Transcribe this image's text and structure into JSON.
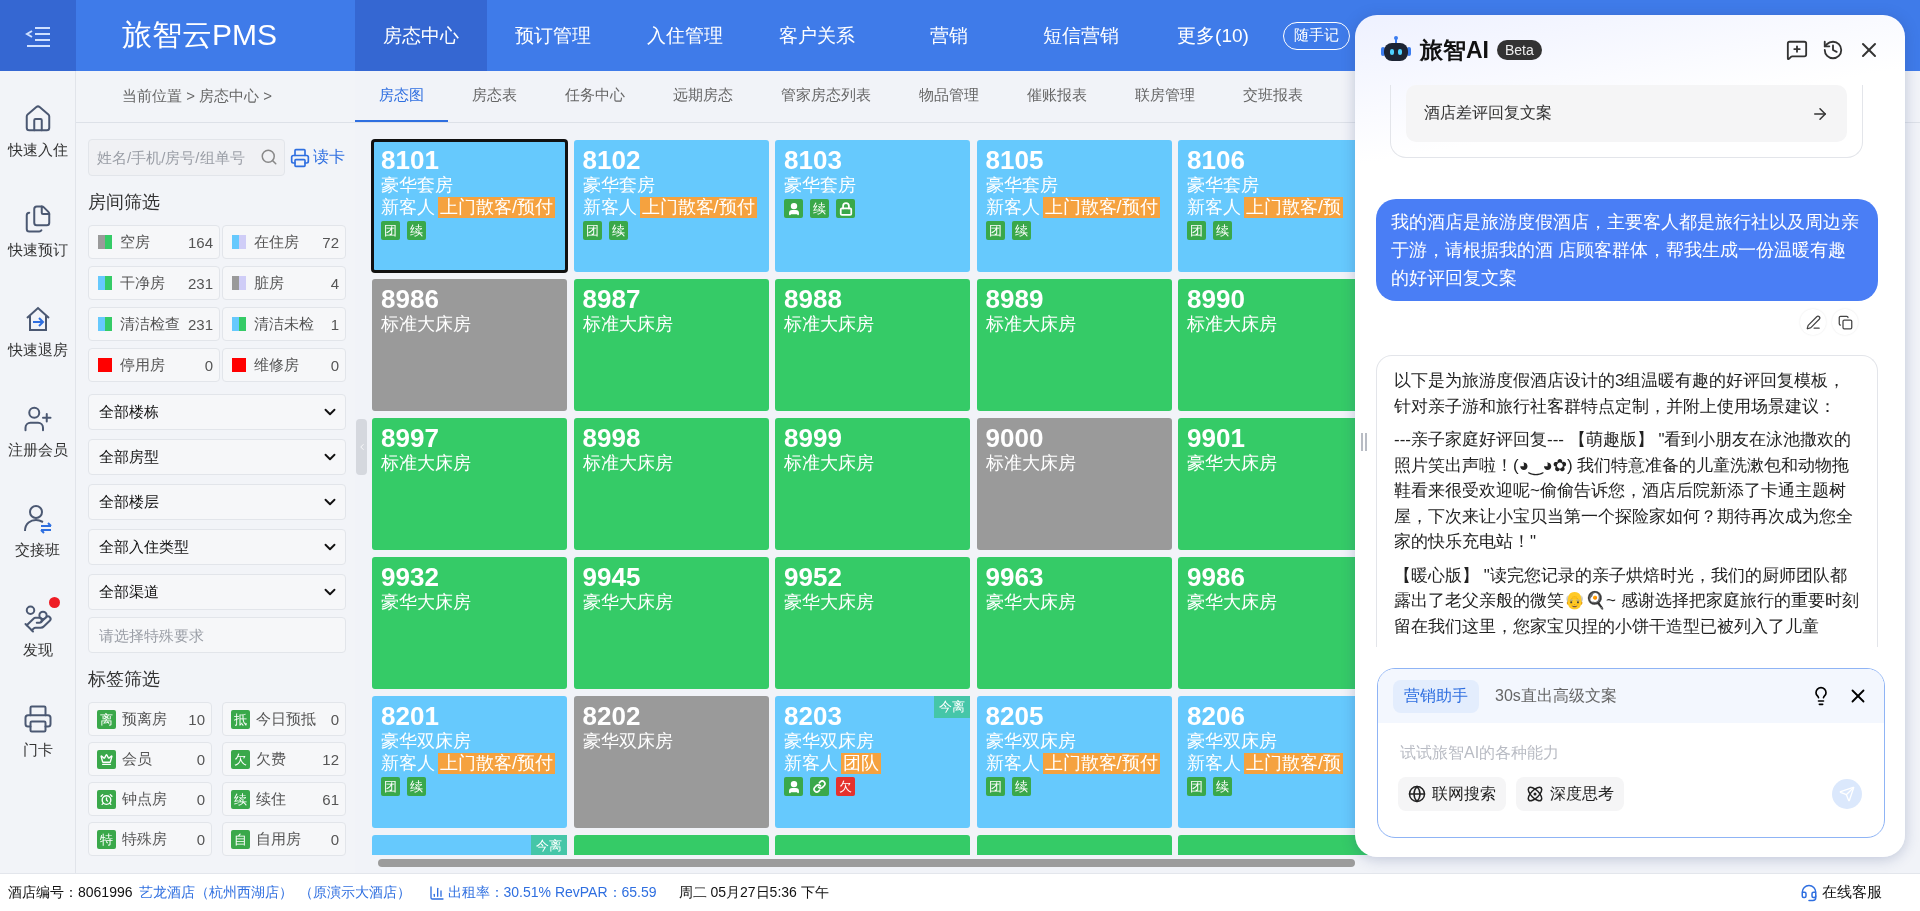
{
  "top_nav": {
    "logo": "旅智云PMS",
    "items": [
      {
        "label": "房态中心",
        "selected": true
      },
      {
        "label": "预订管理",
        "selected": false
      },
      {
        "label": "入住管理",
        "selected": false
      },
      {
        "label": "客户关系",
        "selected": false
      },
      {
        "label": "营销",
        "selected": false
      },
      {
        "label": "短信营销",
        "selected": false
      },
      {
        "label": "更多(10)",
        "selected": false
      }
    ],
    "memo_button": "随手记"
  },
  "sidebar": {
    "items": [
      {
        "kind": "checkin",
        "label": "快速入住",
        "badge": false
      },
      {
        "kind": "booking",
        "label": "快速预订",
        "badge": false
      },
      {
        "kind": "checkout",
        "label": "快速退房",
        "badge": false
      },
      {
        "kind": "member",
        "label": "注册会员",
        "badge": false
      },
      {
        "kind": "handover",
        "label": "交接班",
        "badge": false
      },
      {
        "kind": "discover",
        "label": "发现",
        "badge": true
      },
      {
        "kind": "card",
        "label": "门卡",
        "badge": false
      }
    ]
  },
  "breadcrumb": "当前位置 > 房态中心 >",
  "tabs": [
    {
      "label": "房态图",
      "selected": true
    },
    {
      "label": "房态表",
      "selected": false
    },
    {
      "label": "任务中心",
      "selected": false
    },
    {
      "label": "远期房态",
      "selected": false
    },
    {
      "label": "管家房态列表",
      "selected": false
    },
    {
      "label": "物品管理",
      "selected": false
    },
    {
      "label": "催账报表",
      "selected": false
    },
    {
      "label": "联房管理",
      "selected": false
    },
    {
      "label": "交班报表",
      "selected": false
    }
  ],
  "filter_panel": {
    "search": {
      "placeholder": "姓名/手机/房号/组单号"
    },
    "card_reader": "读卡",
    "room_filter_title": "房间筛选",
    "room_filters": [
      {
        "label": "空房",
        "count": "164",
        "swatch": [
          {
            "color": "#9a9a9a"
          },
          {
            "color": "#35cb67"
          }
        ]
      },
      {
        "label": "在住房",
        "count": "72",
        "swatch": [
          {
            "color": "#66c9fd"
          },
          {
            "color": "#cfcdf7"
          }
        ]
      },
      {
        "label": "干净房",
        "count": "231",
        "swatch": [
          {
            "color": "#66c9fd"
          },
          {
            "color": "#35cb67"
          }
        ]
      },
      {
        "label": "脏房",
        "count": "4",
        "swatch": [
          {
            "color": "#9a9a9a"
          },
          {
            "color": "#cfcdf7"
          }
        ]
      },
      {
        "label": "清洁检查",
        "count": "231",
        "swatch": [
          {
            "color": "#66c9fd"
          },
          {
            "color": "#35cb67"
          }
        ]
      },
      {
        "label": "清洁未检",
        "count": "1",
        "swatch": [
          {
            "color": "#66c9fd"
          },
          {
            "color": "#35cb67"
          }
        ]
      },
      {
        "label": "停用房",
        "count": "0",
        "swatch": [
          {
            "color": "#ff0000"
          }
        ]
      },
      {
        "label": "维修房",
        "count": "0",
        "swatch": [
          {
            "color": "#ff0000"
          }
        ]
      }
    ],
    "selects": [
      "全部楼栋",
      "全部房型",
      "全部楼层",
      "全部入住类型",
      "全部渠道"
    ],
    "special_requirement": {
      "placeholder": "请选择特殊要求"
    },
    "tag_filter_title": "标签筛选",
    "tag_filters": [
      {
        "kind": "char",
        "mark": "离",
        "label": "预离房",
        "count": "10"
      },
      {
        "kind": "char",
        "mark": "抵",
        "label": "今日预抵",
        "count": "0"
      },
      {
        "kind": "vip",
        "label": "会员",
        "count": "0"
      },
      {
        "kind": "char",
        "mark": "欠",
        "label": "欠费",
        "count": "12"
      },
      {
        "kind": "clock",
        "label": "钟点房",
        "count": "0"
      },
      {
        "kind": "char",
        "mark": "续",
        "label": "续住",
        "count": "61"
      },
      {
        "kind": "char",
        "mark": "特",
        "label": "特殊房",
        "count": "0"
      },
      {
        "kind": "char",
        "mark": "自",
        "label": "自用房",
        "count": "0"
      }
    ]
  },
  "rooms": [
    {
      "number": "8101",
      "type": "豪华套房",
      "color": "#66c9fd",
      "selected": true,
      "guest": "新客人",
      "source": "上门散客/预付",
      "icons": [
        {
          "kind": "tag",
          "label": "团"
        },
        {
          "kind": "tag",
          "label": "续"
        }
      ]
    },
    {
      "number": "8102",
      "type": "豪华套房",
      "color": "#66c9fd",
      "selected": false,
      "guest": "新客人",
      "source": "上门散客/预付",
      "icons": [
        {
          "kind": "tag",
          "label": "团"
        },
        {
          "kind": "tag",
          "label": "续"
        }
      ]
    },
    {
      "number": "8103",
      "type": "豪华套房",
      "color": "#66c9fd",
      "selected": false,
      "icons": [
        {
          "kind": "person"
        },
        {
          "kind": "tag",
          "label": "续"
        },
        {
          "kind": "lock"
        }
      ]
    },
    {
      "number": "8105",
      "type": "豪华套房",
      "color": "#66c9fd",
      "selected": false,
      "guest": "新客人",
      "source": "上门散客/预付",
      "icons": [
        {
          "kind": "tag",
          "label": "团"
        },
        {
          "kind": "tag",
          "label": "续"
        }
      ]
    },
    {
      "number": "8106",
      "type": "豪华套房",
      "color": "#66c9fd",
      "selected": false,
      "guest": "新客人",
      "source": "上门散客/预",
      "icons": [
        {
          "kind": "tag",
          "label": "团"
        },
        {
          "kind": "tag",
          "label": "续"
        }
      ]
    },
    {
      "number": "8986",
      "type": "标准大床房",
      "color": "#9a9a9a",
      "selected": false
    },
    {
      "number": "8987",
      "type": "标准大床房",
      "color": "#35cb67",
      "selected": false
    },
    {
      "number": "8988",
      "type": "标准大床房",
      "color": "#35cb67",
      "selected": false
    },
    {
      "number": "8989",
      "type": "标准大床房",
      "color": "#35cb67",
      "selected": false
    },
    {
      "number": "8990",
      "type": "标准大床房",
      "color": "#35cb67",
      "selected": false
    },
    {
      "number": "8997",
      "type": "标准大床房",
      "color": "#35cb67",
      "selected": false
    },
    {
      "number": "8998",
      "type": "标准大床房",
      "color": "#35cb67",
      "selected": false
    },
    {
      "number": "8999",
      "type": "标准大床房",
      "color": "#35cb67",
      "selected": false
    },
    {
      "number": "9000",
      "type": "标准大床房",
      "color": "#9a9a9a",
      "selected": false
    },
    {
      "number": "9901",
      "type": "豪华大床房",
      "color": "#35cb67",
      "selected": false
    },
    {
      "number": "9932",
      "type": "豪华大床房",
      "color": "#35cb67",
      "selected": false
    },
    {
      "number": "9945",
      "type": "豪华大床房",
      "color": "#35cb67",
      "selected": false
    },
    {
      "number": "9952",
      "type": "豪华大床房",
      "color": "#35cb67",
      "selected": false
    },
    {
      "number": "9963",
      "type": "豪华大床房",
      "color": "#35cb67",
      "selected": false
    },
    {
      "number": "9986",
      "type": "豪华大床房",
      "color": "#35cb67",
      "selected": false
    },
    {
      "number": "8201",
      "type": "豪华双床房",
      "color": "#66c9fd",
      "selected": false,
      "guest": "新客人",
      "source": "上门散客/预付",
      "icons": [
        {
          "kind": "tag",
          "label": "团"
        },
        {
          "kind": "tag",
          "label": "续"
        }
      ]
    },
    {
      "number": "8202",
      "type": "豪华双床房",
      "color": "#9a9a9a",
      "selected": false
    },
    {
      "number": "8203",
      "type": "豪华双床房",
      "color": "#66c9fd",
      "selected": false,
      "badge": "今离",
      "guest": "新客人",
      "source": "团队",
      "icons": [
        {
          "kind": "person"
        },
        {
          "kind": "link"
        },
        {
          "kind": "debt",
          "label": "欠"
        }
      ]
    },
    {
      "number": "8205",
      "type": "豪华双床房",
      "color": "#66c9fd",
      "selected": false,
      "guest": "新客人",
      "source": "上门散客/预付",
      "icons": [
        {
          "kind": "tag",
          "label": "团"
        },
        {
          "kind": "tag",
          "label": "续"
        }
      ]
    },
    {
      "number": "8206",
      "type": "豪华双床房",
      "color": "#66c9fd",
      "selected": false,
      "guest": "新客人",
      "source": "上门散客/预",
      "icons": [
        {
          "kind": "tag",
          "label": "团"
        },
        {
          "kind": "tag",
          "label": "续"
        }
      ]
    },
    {
      "color": "#66c9fd",
      "selected": false,
      "badge": "今离"
    },
    {
      "color": "#35cb67",
      "selected": false
    },
    {
      "color": "#35cb67",
      "selected": false
    },
    {
      "color": "#35cb67",
      "selected": false
    },
    {
      "color": "#35cb67",
      "selected": false
    }
  ],
  "status_bar": {
    "hotel_id": "酒店编号：8061996",
    "hotel_name": "艺龙酒店（杭州西湖店）",
    "former_name": "（原演示大酒店）",
    "occupancy": "出租率：30.51% RevPAR：65.59",
    "datetime": "周二 05月27日5:36 下午",
    "support": "在线客服"
  },
  "ai_panel": {
    "title": "旅智AI",
    "beta": "Beta",
    "suggestion": "酒店差评回复文案",
    "user_message": "我的酒店是旅游度假酒店，主要客人都是旅行社以及周边亲于游，请根据我的酒 店顾客群体，帮我生成一份温暖有趣的好评回复文案",
    "reply_paragraphs": [
      "以下是为旅游度假酒店设计的3组温暖有趣的好评回复模板，针对亲子游和旅行社客群特点定制，并附上使用场景建议：",
      "---亲子家庭好评回复--- 【萌趣版】 \"看到小朋友在泳池撒欢的照片笑出声啦！(◕‿◕✿) 我们特意准备的儿童洗漱包和动物拖鞋看来很受欢迎呢~偷偷告诉您，酒店后院新添了卡通主题树屋，下次来让小宝贝当第一个探险家如何？期待再次成为您全家的快乐充电站！\"",
      "【暖心版】 \"读完您记录的亲子烘焙时光，我们的厨师团队都露出了老父亲般的微笑👴🍳~ 感谢选择把家庭旅行的重要时刻留在我们这里，您家宝贝捏的小饼干造型已被列入了儿童"
    ],
    "input": {
      "mode_chip": "营销助手",
      "mode_hint": "30s直出高级文案",
      "placeholder": "试试旅智AI的各种能力",
      "tools": [
        {
          "kind": "web",
          "label": "联网搜索"
        },
        {
          "kind": "think",
          "label": "深度思考"
        }
      ],
      "send_disabled": true
    }
  }
}
